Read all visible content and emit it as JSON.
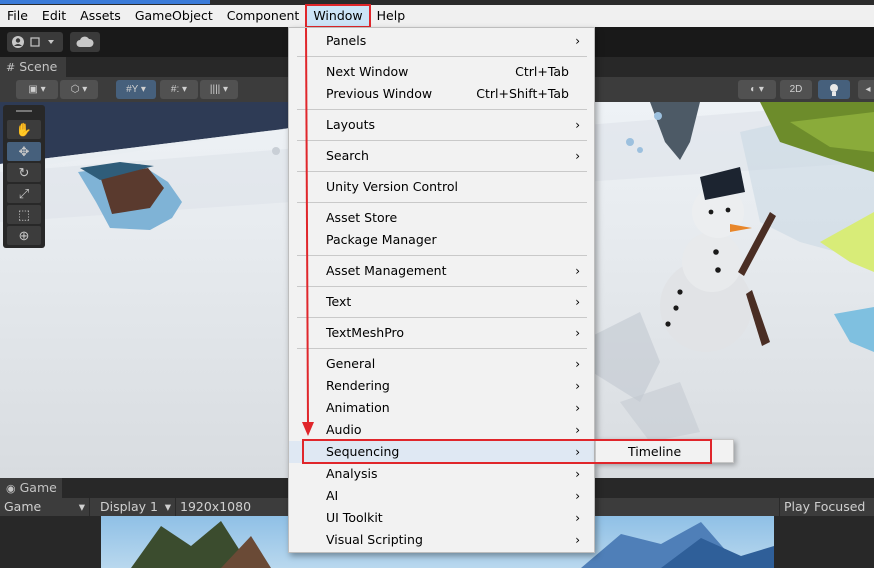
{
  "menubar": {
    "items": [
      "File",
      "Edit",
      "Assets",
      "GameObject",
      "Component",
      "Window",
      "Help"
    ],
    "active": "Window"
  },
  "scene": {
    "tab_label": "Scene",
    "toolbar_2d_label": "2D"
  },
  "window_menu": {
    "items": [
      {
        "label": "Panels",
        "submenu": true
      },
      {
        "label": "Next Window",
        "shortcut": "Ctrl+Tab"
      },
      {
        "label": "Previous Window",
        "shortcut": "Ctrl+Shift+Tab"
      },
      {
        "label": "Layouts",
        "submenu": true
      },
      {
        "label": "Search",
        "submenu": true
      },
      {
        "label": "Unity Version Control"
      },
      {
        "label": "Asset Store"
      },
      {
        "label": "Package Manager"
      },
      {
        "label": "Asset Management",
        "submenu": true
      },
      {
        "label": "Text",
        "submenu": true
      },
      {
        "label": "TextMeshPro",
        "submenu": true
      },
      {
        "label": "General",
        "submenu": true
      },
      {
        "label": "Rendering",
        "submenu": true
      },
      {
        "label": "Animation",
        "submenu": true
      },
      {
        "label": "Audio",
        "submenu": true
      },
      {
        "label": "Sequencing",
        "submenu": true,
        "highlighted": true
      },
      {
        "label": "Analysis",
        "submenu": true
      },
      {
        "label": "AI",
        "submenu": true
      },
      {
        "label": "UI Toolkit",
        "submenu": true
      },
      {
        "label": "Visual Scripting",
        "submenu": true
      }
    ],
    "submenu_arrow": "›"
  },
  "sequencing_submenu": {
    "items": [
      "Timeline"
    ]
  },
  "game": {
    "tab_label": "Game",
    "view_select": "Game",
    "display_select": "Display 1",
    "resolution": "1920x1080",
    "play_mode": "Play Focused"
  },
  "colors": {
    "annotation_red": "#e0262b",
    "highlight": "#dfe8f3"
  }
}
